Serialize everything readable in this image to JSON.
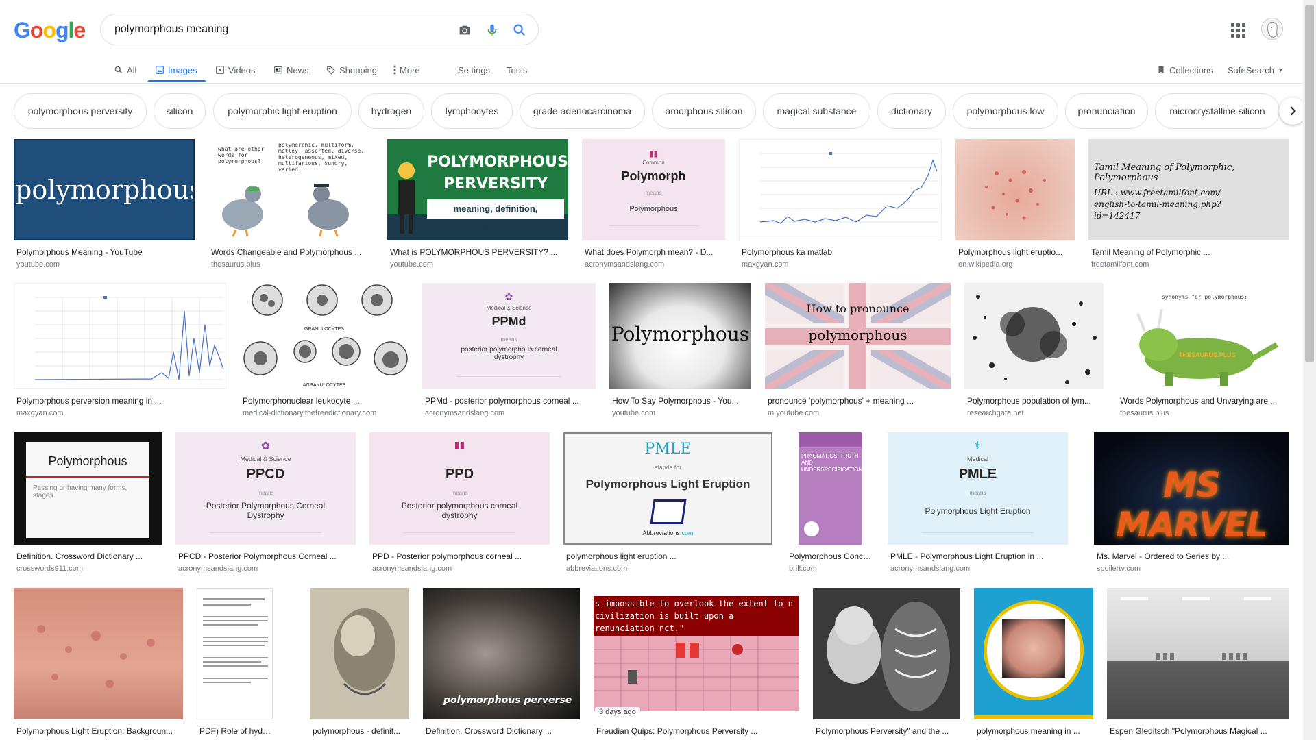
{
  "logo": {
    "letters": [
      "G",
      "o",
      "o",
      "g",
      "l",
      "e"
    ],
    "colors": [
      "#4285f4",
      "#ea4335",
      "#fbbc05",
      "#4285f4",
      "#34a853",
      "#ea4335"
    ]
  },
  "search": {
    "query": "polymorphous meaning",
    "placeholder": ""
  },
  "nav": {
    "all": "All",
    "images": "Images",
    "videos": "Videos",
    "news": "News",
    "shopping": "Shopping",
    "more": "More",
    "settings": "Settings",
    "tools": "Tools",
    "collections": "Collections",
    "safesearch": "SafeSearch"
  },
  "chips": [
    "polymorphous perversity",
    "silicon",
    "polymorphic light eruption",
    "hydrogen",
    "lymphocytes",
    "grade adenocarcinoma",
    "amorphous silicon",
    "magical substance",
    "dictionary",
    "polymorphous low",
    "pronunciation",
    "microcrystalline silicon"
  ],
  "thumb_text": {
    "r1_0": "polymorphous",
    "r1_1_q": "what are other words for polymorphous?",
    "r1_1_a": "polymorphic, multiform, motley, assorted, diverse, heterogeneous, mixed, multifarious, sundry, varied",
    "r1_2_a": "POLYMORPHOUS",
    "r1_2_b": "PERVERSITY",
    "r1_2_c": "meaning, definition, explanation...",
    "r1_3_a": "Common",
    "r1_3_b": "Polymorph",
    "r1_3_c": "means",
    "r1_3_d": "Polymorphous",
    "r1_6_a": "Tamil Meaning of Polymorphic, Polymorphous",
    "r1_6_b": "URL : www.freetamilfont.com/ english-to-tamil-meaning.php?id=142417",
    "r2_1": "GRANULOCYTES",
    "r2_1b": "AGRANULOCYTES",
    "r2_2_a": "Medical & Science",
    "r2_2_b": "PPMd",
    "r2_2_c": "means",
    "r2_2_d": "posterior polymorphous corneal dystrophy",
    "r2_3": "Polymorphous",
    "r2_4_a": "How to pronounce",
    "r2_4_b": "polymorphous",
    "r2_6": "synonyms for polymorphous:",
    "r2_6b": "THESAURUS.PLUS",
    "r3_0_a": "Polymorphous",
    "r3_0_b": "Passing or having many forms, stages",
    "r3_1_a": "Medical & Science",
    "r3_1_b": "PPCD",
    "r3_1_c": "means",
    "r3_1_d": "Posterior Polymorphous Corneal Dystrophy",
    "r3_2_b": "PPD",
    "r3_2_c": "means",
    "r3_2_d": "Posterior polymorphous corneal dystrophy",
    "r3_3_a": "PMLE",
    "r3_3_b": "stands for",
    "r3_3_c": "Polymorphous Light Eruption",
    "r3_3_d": "Abbreviations",
    "r3_3_e": ".com",
    "r3_4_a": "PRAGMATICS, TRUTH AND UNDERSPECIFICATION",
    "r3_5_a": "Medical",
    "r3_5_b": "PMLE",
    "r3_5_c": "means",
    "r3_5_d": "Polymorphous Light Eruption",
    "r3_6": "MS MARVEL",
    "r4_3": "polymorphous perverse",
    "r4_4": "s impossible to overlook the extent to n civilization is built upon a renunciation nct.\""
  },
  "results": [
    {
      "caption": "Polymorphous Meaning - YouTube",
      "domain": "youtube.com"
    },
    {
      "caption": "Words Changeable and Polymorphous ...",
      "domain": "thesaurus.plus"
    },
    {
      "caption": "What is POLYMORPHOUS PERVERSITY? ...",
      "domain": "youtube.com"
    },
    {
      "caption": "What does Polymorph mean? - D...",
      "domain": "acronymsandslang.com"
    },
    {
      "caption": "Polymorphous ka matlab",
      "domain": "maxgyan.com"
    },
    {
      "caption": "Polymorphous light eruptio...",
      "domain": "en.wikipedia.org"
    },
    {
      "caption": "Tamil Meaning of Polymorphic ...",
      "domain": "freetamilfont.com"
    },
    {
      "caption": "Polymorphous perversion meaning in ...",
      "domain": "maxgyan.com"
    },
    {
      "caption": "Polymorphonuclear leukocyte ...",
      "domain": "medical-dictionary.thefreedictionary.com"
    },
    {
      "caption": "PPMd - posterior polymorphous corneal ...",
      "domain": "acronymsandslang.com"
    },
    {
      "caption": "How To Say Polymorphous - You...",
      "domain": "youtube.com"
    },
    {
      "caption": "pronounce 'polymorphous' + meaning ...",
      "domain": "m.youtube.com"
    },
    {
      "caption": "Polymorphous population of lym...",
      "domain": "researchgate.net"
    },
    {
      "caption": "Words Polymorphous and Unvarying are ...",
      "domain": "thesaurus.plus"
    },
    {
      "caption": "Definition. Crossword Dictionary ...",
      "domain": "crosswords911.com"
    },
    {
      "caption": "PPCD - Posterior Polymorphous Corneal ...",
      "domain": "acronymsandslang.com"
    },
    {
      "caption": "PPD - Posterior polymorphous corneal ...",
      "domain": "acronymsandslang.com"
    },
    {
      "caption": "polymorphous light eruption ...",
      "domain": "abbreviations.com"
    },
    {
      "caption": "Polymorphous Conce...",
      "domain": "brill.com"
    },
    {
      "caption": "PMLE - Polymorphous Light Eruption in ...",
      "domain": "acronymsandslang.com"
    },
    {
      "caption": "Ms. Marvel - Ordered to Series by ...",
      "domain": "spoilertv.com"
    },
    {
      "caption": "Polymorphous Light Eruption: Backgroun...",
      "domain": ""
    },
    {
      "caption": "PDF) Role of hydroge...",
      "domain": ""
    },
    {
      "caption": "polymorphous - definit...",
      "domain": ""
    },
    {
      "caption": "Definition. Crossword Dictionary ...",
      "domain": ""
    },
    {
      "caption": "Freudian Quips: Polymorphous Perversity ...",
      "domain": "",
      "badge": "3 days ago"
    },
    {
      "caption": "Polymorphous Perversity\" and the ...",
      "domain": ""
    },
    {
      "caption": "polymorphous meaning in ...",
      "domain": ""
    },
    {
      "caption": "Espen Gleditsch \"Polymorphous Magical ...",
      "domain": ""
    }
  ]
}
